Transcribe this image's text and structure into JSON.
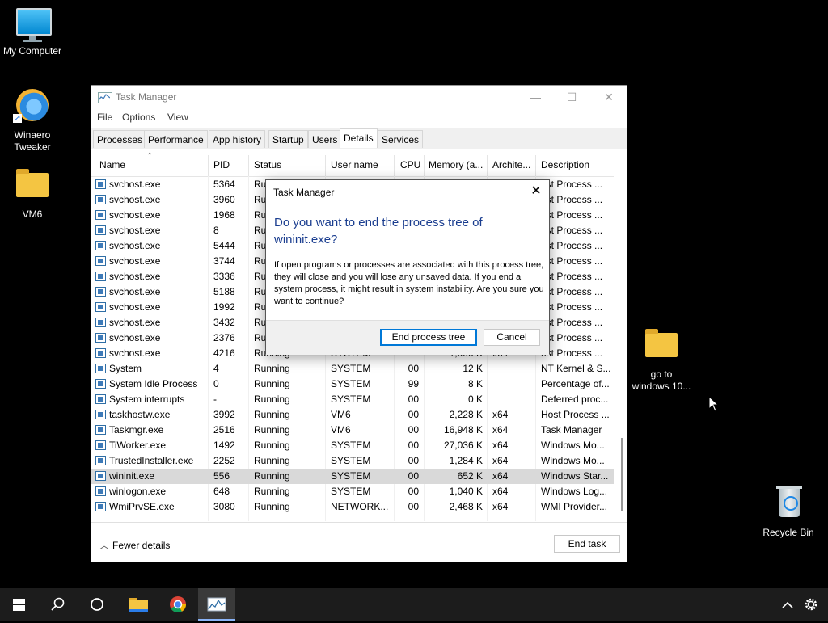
{
  "desktop": {
    "icons": [
      {
        "label": "My Computer",
        "icon": "monitor-icon"
      },
      {
        "label": "Winaero\nTweaker",
        "label_line1": "Winaero",
        "label_line2": "Tweaker",
        "icon": "winaero-icon"
      },
      {
        "label": "VM6",
        "icon": "folder-icon"
      },
      {
        "label_line1": "go to",
        "label_line2": "windows 10...",
        "icon": "folder-icon"
      },
      {
        "label": "Recycle Bin",
        "icon": "recycle-bin-icon"
      }
    ]
  },
  "task_manager": {
    "title": "Task Manager",
    "menu": [
      "File",
      "Options",
      "View"
    ],
    "tabs": [
      "Processes",
      "Performance",
      "App history",
      "Startup",
      "Users",
      "Details",
      "Services"
    ],
    "active_tab": "Details",
    "columns": [
      "Name",
      "PID",
      "Status",
      "User name",
      "CPU",
      "Memory (a...",
      "Archite...",
      "Description"
    ],
    "rows": [
      {
        "name": "svchost.exe",
        "pid": "5364",
        "status": "Ru",
        "user": "",
        "cpu": "",
        "mem": "",
        "arch": "",
        "desc": "ost Process ..."
      },
      {
        "name": "svchost.exe",
        "pid": "3960",
        "status": "Ru",
        "user": "",
        "cpu": "",
        "mem": "",
        "arch": "",
        "desc": "ost Process ..."
      },
      {
        "name": "svchost.exe",
        "pid": "1968",
        "status": "Ru",
        "user": "",
        "cpu": "",
        "mem": "",
        "arch": "",
        "desc": "ost Process ..."
      },
      {
        "name": "svchost.exe",
        "pid": "8",
        "status": "Ru",
        "user": "",
        "cpu": "",
        "mem": "",
        "arch": "",
        "desc": "ost Process ..."
      },
      {
        "name": "svchost.exe",
        "pid": "5444",
        "status": "Ru",
        "user": "",
        "cpu": "",
        "mem": "",
        "arch": "",
        "desc": "ost Process ..."
      },
      {
        "name": "svchost.exe",
        "pid": "3744",
        "status": "Ru",
        "user": "",
        "cpu": "",
        "mem": "",
        "arch": "",
        "desc": "ost Process ..."
      },
      {
        "name": "svchost.exe",
        "pid": "3336",
        "status": "Ru",
        "user": "",
        "cpu": "",
        "mem": "",
        "arch": "",
        "desc": "ost Process ..."
      },
      {
        "name": "svchost.exe",
        "pid": "5188",
        "status": "Ru",
        "user": "",
        "cpu": "",
        "mem": "",
        "arch": "",
        "desc": "ost Process ..."
      },
      {
        "name": "svchost.exe",
        "pid": "1992",
        "status": "Ru",
        "user": "",
        "cpu": "",
        "mem": "",
        "arch": "",
        "desc": "ost Process ..."
      },
      {
        "name": "svchost.exe",
        "pid": "3432",
        "status": "Ru",
        "user": "",
        "cpu": "",
        "mem": "",
        "arch": "",
        "desc": "ost Process ..."
      },
      {
        "name": "svchost.exe",
        "pid": "2376",
        "status": "Ru",
        "user": "",
        "cpu": "",
        "mem": "",
        "arch": "",
        "desc": "ost Process ..."
      },
      {
        "name": "svchost.exe",
        "pid": "4216",
        "status": "Running",
        "user": "SYSTEM",
        "cpu": "",
        "mem": "1,000 K",
        "arch": "x64",
        "desc": "ost Process ..."
      },
      {
        "name": "System",
        "pid": "4",
        "status": "Running",
        "user": "SYSTEM",
        "cpu": "00",
        "mem": "12 K",
        "arch": "",
        "desc": "NT Kernel & S..."
      },
      {
        "name": "System Idle Process",
        "pid": "0",
        "status": "Running",
        "user": "SYSTEM",
        "cpu": "99",
        "mem": "8 K",
        "arch": "",
        "desc": "Percentage of..."
      },
      {
        "name": "System interrupts",
        "pid": "-",
        "status": "Running",
        "user": "SYSTEM",
        "cpu": "00",
        "mem": "0 K",
        "arch": "",
        "desc": "Deferred proc..."
      },
      {
        "name": "taskhostw.exe",
        "pid": "3992",
        "status": "Running",
        "user": "VM6",
        "cpu": "00",
        "mem": "2,228 K",
        "arch": "x64",
        "desc": "Host Process ..."
      },
      {
        "name": "Taskmgr.exe",
        "pid": "2516",
        "status": "Running",
        "user": "VM6",
        "cpu": "00",
        "mem": "16,948 K",
        "arch": "x64",
        "desc": "Task Manager"
      },
      {
        "name": "TiWorker.exe",
        "pid": "1492",
        "status": "Running",
        "user": "SYSTEM",
        "cpu": "00",
        "mem": "27,036 K",
        "arch": "x64",
        "desc": "Windows Mo..."
      },
      {
        "name": "TrustedInstaller.exe",
        "pid": "2252",
        "status": "Running",
        "user": "SYSTEM",
        "cpu": "00",
        "mem": "1,284 K",
        "arch": "x64",
        "desc": "Windows Mo..."
      },
      {
        "name": "wininit.exe",
        "pid": "556",
        "status": "Running",
        "user": "SYSTEM",
        "cpu": "00",
        "mem": "652 K",
        "arch": "x64",
        "desc": "Windows Star...",
        "selected": true
      },
      {
        "name": "winlogon.exe",
        "pid": "648",
        "status": "Running",
        "user": "SYSTEM",
        "cpu": "00",
        "mem": "1,040 K",
        "arch": "x64",
        "desc": "Windows Log..."
      },
      {
        "name": "WmiPrvSE.exe",
        "pid": "3080",
        "status": "Running",
        "user": "NETWORK...",
        "cpu": "00",
        "mem": "2,468 K",
        "arch": "x64",
        "desc": "WMI Provider..."
      }
    ],
    "fewer_details": "Fewer details",
    "end_task": "End task"
  },
  "dialog": {
    "title": "Task Manager",
    "main_line1": "Do you want to end the process tree of",
    "main_line2": "wininit.exe?",
    "body": "If open programs or processes are associated with this process tree, they will close and you will lose any unsaved data. If you end a system process, it might result in system instability. Are you sure you want to continue?",
    "confirm": "End process tree",
    "cancel": "Cancel"
  },
  "taskbar": {
    "items": [
      "start-icon",
      "search-icon",
      "cortana-icon",
      "file-explorer-icon",
      "chrome-icon",
      "task-manager-icon"
    ],
    "tray": [
      "chevron-up-icon",
      "gear-icon"
    ]
  },
  "colors": {
    "dialog_heading": "#1a3d8f",
    "selected_row": "#d9d9d9",
    "taskbar": "#1c1c1c"
  }
}
